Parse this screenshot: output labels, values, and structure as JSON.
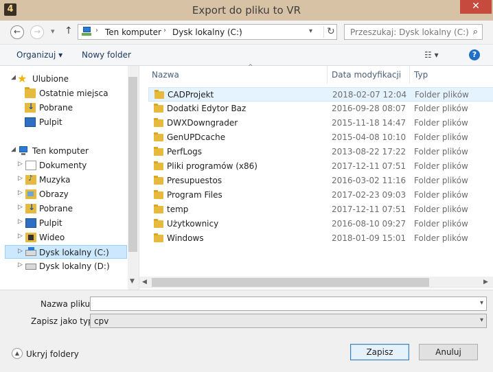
{
  "window": {
    "app_icon": "4",
    "title": "Export do pliku to VR",
    "close": "✕"
  },
  "navigation": {
    "back": "←",
    "forward": "→",
    "recent": "▾",
    "up": "↑",
    "address": [
      "Ten komputer",
      "Dysk lokalny (C:)"
    ],
    "address_separator": "›",
    "address_dropdown": "▾",
    "refresh": "↻",
    "search_placeholder": "Przeszukaj: Dysk lokalny (C:)",
    "search_icon": "⌕"
  },
  "toolbar": {
    "organize": "Organizuj ▾",
    "new_folder": "Nowy folder",
    "view": "☷ ▾",
    "help": "?"
  },
  "sidebar": {
    "items": [
      {
        "label": "Ulubione",
        "icon": "star-icon",
        "expander": "◢"
      },
      {
        "label": "Ostatnie miejsca",
        "icon": "recent-places-icon",
        "expander": ""
      },
      {
        "label": "Pobrane",
        "icon": "downloads-icon",
        "expander": ""
      },
      {
        "label": "Pulpit",
        "icon": "desktop-icon",
        "expander": ""
      },
      {
        "label": "Ten komputer",
        "icon": "computer-icon",
        "expander": "◢"
      },
      {
        "label": "Dokumenty",
        "icon": "documents-icon",
        "expander": "▷"
      },
      {
        "label": "Muzyka",
        "icon": "music-icon",
        "expander": "▷"
      },
      {
        "label": "Obrazy",
        "icon": "pictures-icon",
        "expander": "▷"
      },
      {
        "label": "Pobrane",
        "icon": "downloads-icon",
        "expander": "▷"
      },
      {
        "label": "Pulpit",
        "icon": "desktop-icon",
        "expander": "▷"
      },
      {
        "label": "Wideo",
        "icon": "video-icon",
        "expander": "▷"
      },
      {
        "label": "Dysk lokalny (C:)",
        "icon": "local-drive-icon",
        "expander": "▷"
      },
      {
        "label": "Dysk lokalny (D:)",
        "icon": "local-drive-icon",
        "expander": "▷"
      }
    ],
    "scroll_down": "▼"
  },
  "file_list": {
    "columns": [
      "Nazwa",
      "Data modyfikacji",
      "Typ"
    ],
    "sort_indicator": "^",
    "rows": [
      {
        "name": "CADProjekt",
        "date": "2018-02-07 12:04",
        "type": "Folder plików"
      },
      {
        "name": "Dodatki Edytor Baz",
        "date": "2016-09-28 08:07",
        "type": "Folder plików"
      },
      {
        "name": "DWXDowngrader",
        "date": "2015-11-18 14:47",
        "type": "Folder plików"
      },
      {
        "name": "GenUPDcache",
        "date": "2015-04-08 10:10",
        "type": "Folder plików"
      },
      {
        "name": "PerfLogs",
        "date": "2013-08-22 17:22",
        "type": "Folder plików"
      },
      {
        "name": "Pliki programów (x86)",
        "date": "2017-12-11 07:51",
        "type": "Folder plików"
      },
      {
        "name": "Presupuestos",
        "date": "2016-03-02 11:16",
        "type": "Folder plików"
      },
      {
        "name": "Program Files",
        "date": "2017-02-23 09:03",
        "type": "Folder plików"
      },
      {
        "name": "temp",
        "date": "2017-12-11 07:51",
        "type": "Folder plików"
      },
      {
        "name": "Użytkownicy",
        "date": "2016-08-10 09:27",
        "type": "Folder plików"
      },
      {
        "name": "Windows",
        "date": "2018-01-09 15:01",
        "type": "Folder plików"
      }
    ],
    "scroll_left": "◀",
    "scroll_right": "▶"
  },
  "save_form": {
    "filename_label": "Nazwa pliku:",
    "filename_value": "",
    "type_label": "Zapisz jako typ:",
    "type_value": "cpv",
    "dropdown": "▾"
  },
  "footer": {
    "hide_folders": "Ukryj foldery",
    "hide_icon": "▲",
    "save": "Zapisz",
    "cancel": "Anuluj"
  }
}
